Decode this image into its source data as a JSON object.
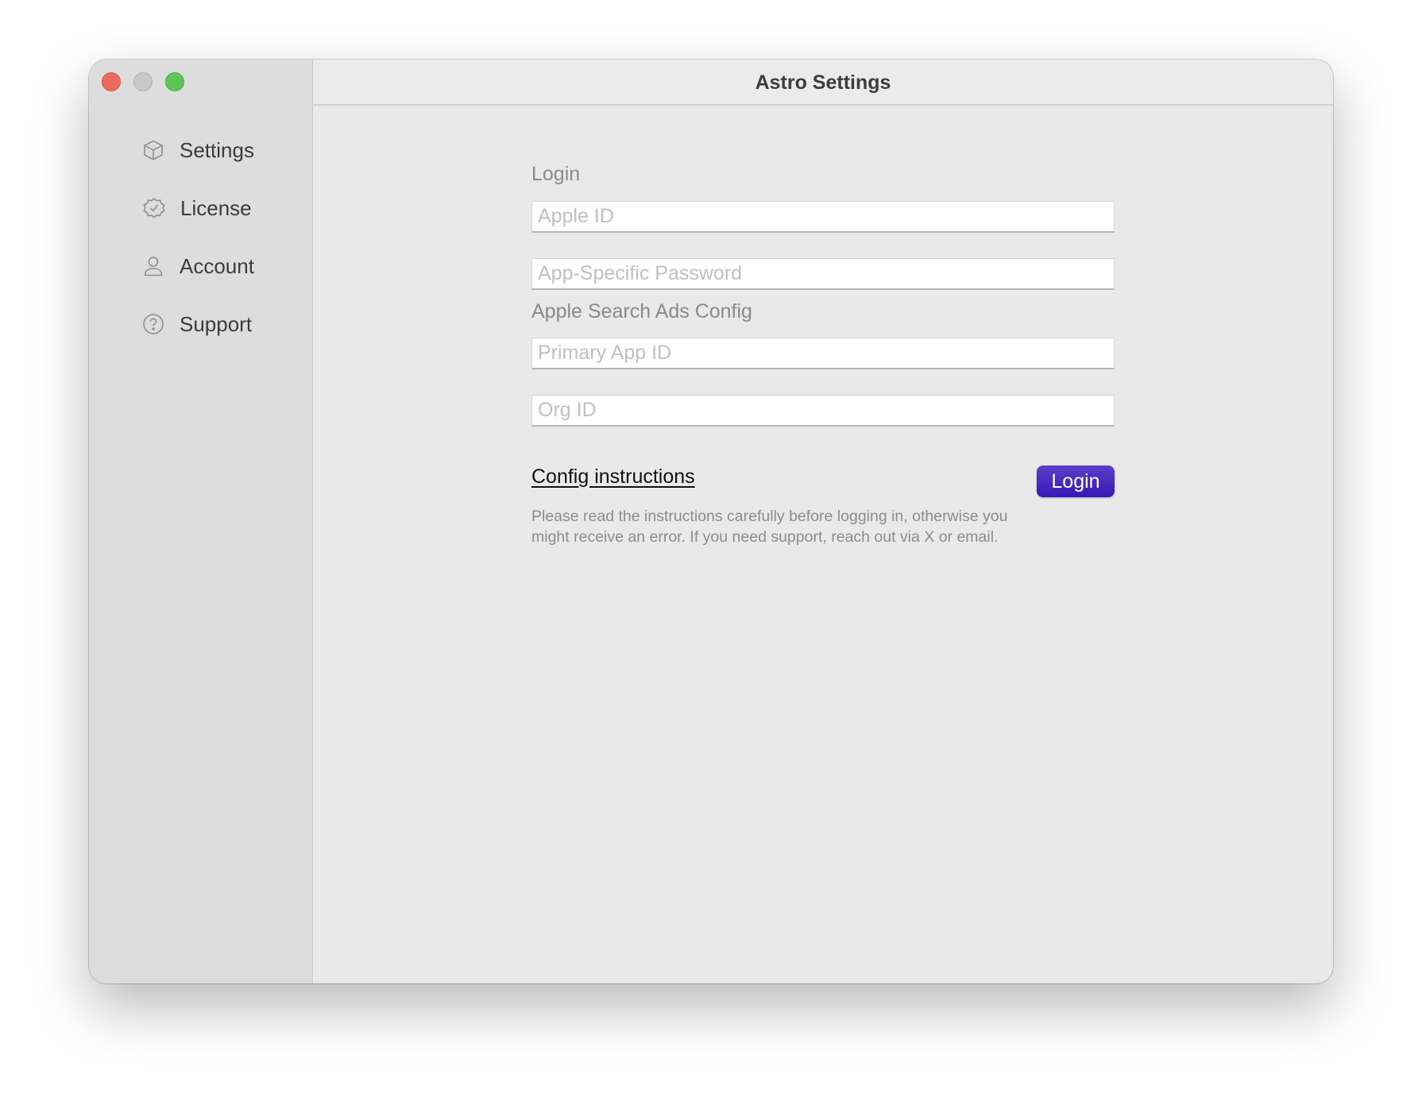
{
  "window": {
    "title": "Astro Settings",
    "traffic_lights": [
      "close",
      "minimize",
      "zoom"
    ]
  },
  "sidebar": {
    "items": [
      {
        "label": "Settings",
        "icon": "cube-icon"
      },
      {
        "label": "License",
        "icon": "checkmark-seal-icon"
      },
      {
        "label": "Account",
        "icon": "person-icon"
      },
      {
        "label": "Support",
        "icon": "question-circle-icon"
      }
    ]
  },
  "form": {
    "login_section": "Login",
    "apple_id": {
      "placeholder": "Apple ID",
      "value": ""
    },
    "app_password": {
      "placeholder": "App-Specific Password",
      "value": ""
    },
    "ads_section": "Apple Search Ads Config",
    "primary_app_id": {
      "placeholder": "Primary App ID",
      "value": ""
    },
    "org_id": {
      "placeholder": "Org ID",
      "value": ""
    },
    "config_link": "Config instructions",
    "login_button": "Login",
    "description": "Please read the instructions carefully before logging in, otherwise you might receive an error. If you need support, reach out via X or email."
  },
  "colors": {
    "accent": "#4a2cc2",
    "close": "#ed6a5e",
    "minimize": "#c8c8c8",
    "zoom": "#5ec453"
  }
}
